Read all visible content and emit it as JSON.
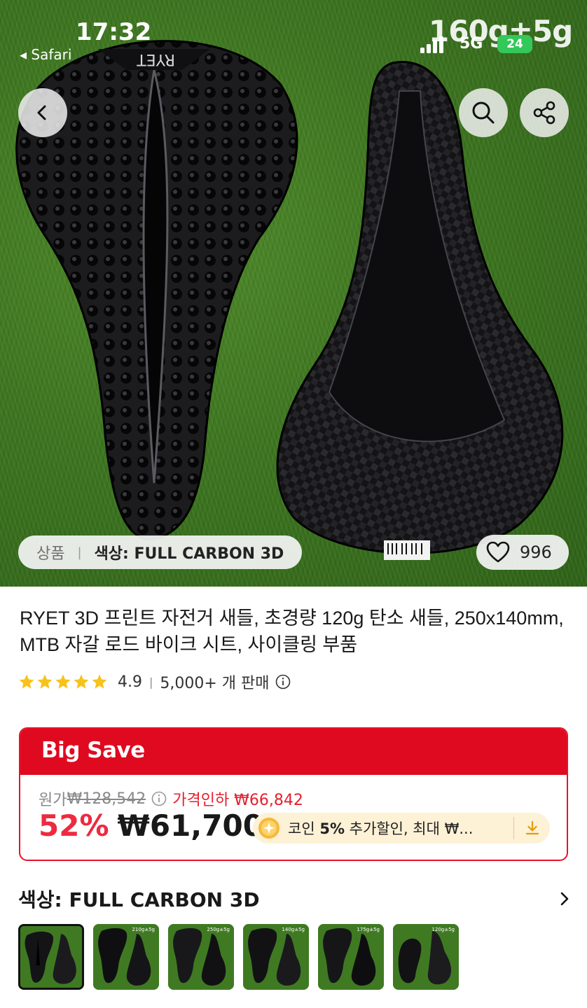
{
  "status_bar": {
    "time": "17:32",
    "back_app": "◂ Safari",
    "network": "5G",
    "battery": "24",
    "overlay_text": "160g±5g"
  },
  "gallery": {
    "option_label": "상품",
    "selected_variant": "색상: FULL CARBON 3D",
    "wishlist_count": "996"
  },
  "product": {
    "title": "RYET 3D 프린트 자전거 새들, 초경량 120g 탄소 새들, 250x140mm, MTB 자갈 로드 바이크 시트, 사이클링 부품",
    "rating": "4.9",
    "sold": "5,000+ 개 판매",
    "star_count": 5
  },
  "deal": {
    "banner": "Big Save",
    "original_label": "원가",
    "original_price": "₩128,542",
    "price_cut": "가격인하 ₩66,842",
    "discount": "52%",
    "price": "₩61,700",
    "coin_prefix": "코인",
    "coin_pct": "5%",
    "coin_suffix": "추가할인, 최대 ₩..."
  },
  "variants": {
    "title": "색상: FULL CARBON 3D",
    "thumbnail_tags": [
      "",
      "210g±5g",
      "250g±5g",
      "140g±5g",
      "175g±5g",
      "120g±5g"
    ]
  },
  "colors": {
    "accent_red": "#df0a20",
    "price_red": "#ee2a41",
    "star_yellow": "#f7c21b",
    "coin_bg": "#fdf1d6"
  },
  "icons": [
    "back-icon",
    "search-icon",
    "share-icon",
    "heart-icon",
    "star-icon",
    "info-icon",
    "coin-icon",
    "download-icon",
    "chevron-right-icon"
  ]
}
